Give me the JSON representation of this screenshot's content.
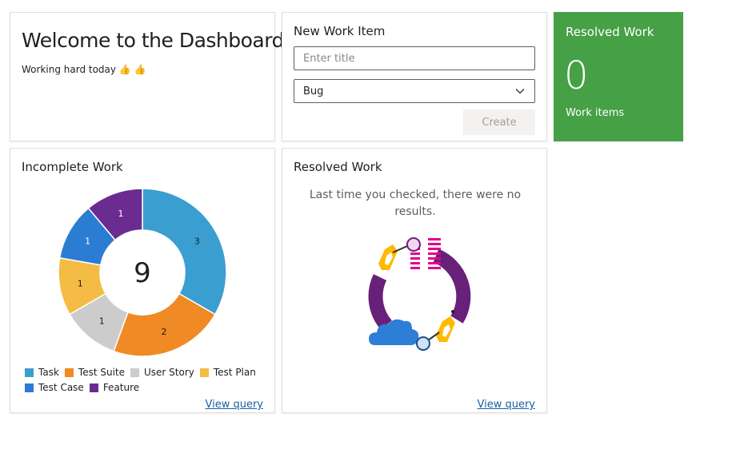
{
  "welcome": {
    "title": "Welcome to the Dashboard",
    "subtitle": "Working hard today 👍 👍"
  },
  "new_work_item": {
    "title": "New Work Item",
    "title_placeholder": "Enter title",
    "type_value": "Bug",
    "create_label": "Create"
  },
  "resolved_big": {
    "title": "Resolved Work",
    "count": "0",
    "label": "Work items",
    "color": "#46a046"
  },
  "incomplete": {
    "title": "Incomplete Work",
    "total": "9",
    "view_query": "View query"
  },
  "resolved_empty": {
    "title": "Resolved Work",
    "message": "Last time you checked, there were no results.",
    "view_query": "View query"
  },
  "chart_data": {
    "type": "pie",
    "variant": "donut",
    "center_label": "9",
    "categories": [
      "Task",
      "Test Suite",
      "User Story",
      "Test Plan",
      "Test Case",
      "Feature"
    ],
    "values": [
      3,
      2,
      1,
      1,
      1,
      1
    ],
    "colors": [
      "#3b9ed0",
      "#f08a24",
      "#cccccc",
      "#f5bc45",
      "#2b7cd3",
      "#6b2c91"
    ],
    "legend_placement": "bottom"
  }
}
